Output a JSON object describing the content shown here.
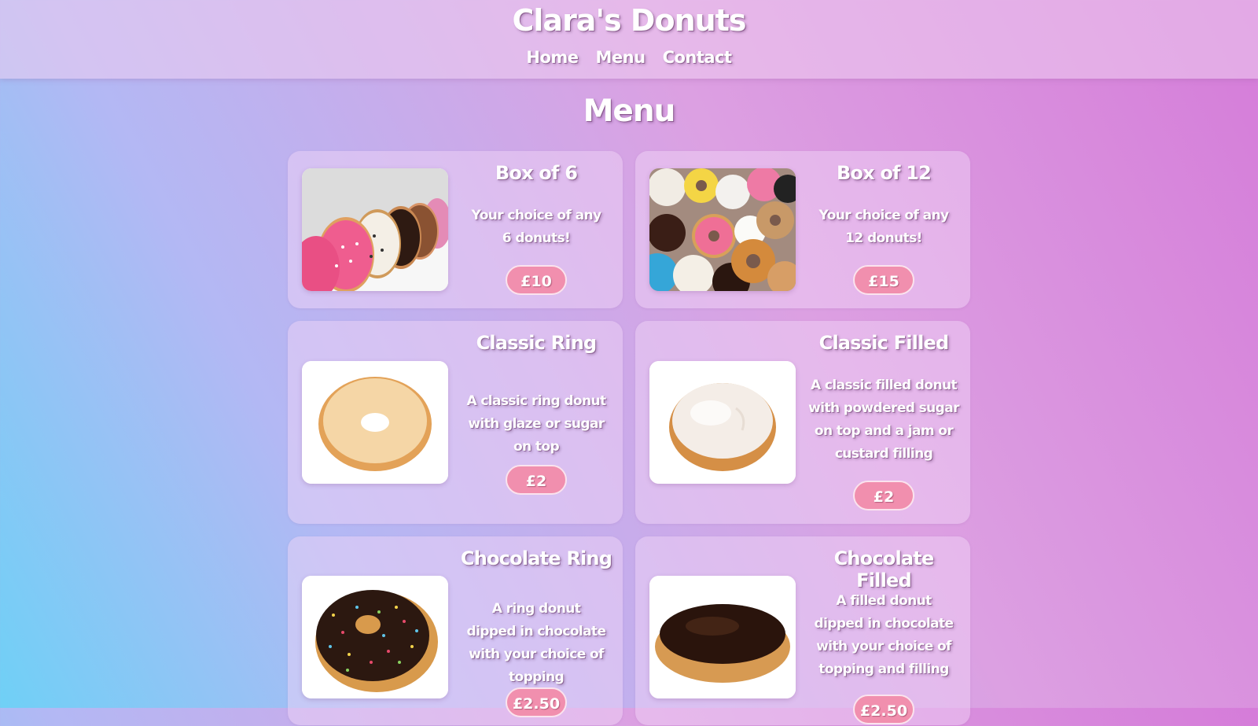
{
  "header": {
    "site_title": "Clara's Donuts",
    "nav": [
      {
        "label": "Home"
      },
      {
        "label": "Menu"
      },
      {
        "label": "Contact"
      }
    ]
  },
  "page": {
    "heading": "Menu"
  },
  "products": [
    {
      "name": "Box of 6",
      "description": "Your choice of any 6 donuts!",
      "price": "£10",
      "icon": "donut-box-6-image"
    },
    {
      "name": "Box of 12",
      "description": "Your choice of any 12 donuts!",
      "price": "£15",
      "icon": "donut-box-12-image"
    },
    {
      "name": "Classic Ring",
      "description": "A classic ring donut with glaze or sugar on top",
      "price": "£2",
      "icon": "classic-ring-donut-image"
    },
    {
      "name": "Classic Filled",
      "description": "A classic filled donut with powdered sugar on top and a jam or custard filling",
      "price": "£2",
      "icon": "classic-filled-donut-image"
    },
    {
      "name": "Chocolate Ring",
      "description": "A ring donut dipped in chocolate with your choice of topping",
      "price": "£2.50",
      "icon": "chocolate-ring-donut-image"
    },
    {
      "name": "Chocolate Filled",
      "description": "A filled donut dipped in chocolate with your choice of topping and filling",
      "price": "£2.50",
      "icon": "chocolate-filled-donut-image"
    }
  ],
  "colors": {
    "price_button": "#f18fae",
    "text": "#ffffff",
    "gradient_start": "#6fd0f6",
    "gradient_end": "#d57cd9"
  }
}
